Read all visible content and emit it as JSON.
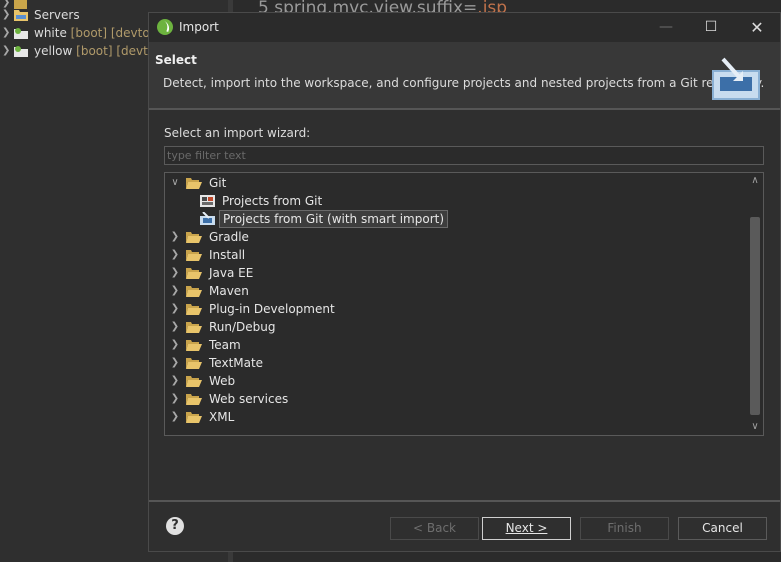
{
  "explorer": {
    "items": [
      {
        "name": "Servers",
        "meta": ""
      },
      {
        "name": "white",
        "meta": "[boot] [devtool"
      },
      {
        "name": "yellow",
        "meta": "[boot] [devtoo"
      }
    ]
  },
  "editor": {
    "line_number": "5",
    "line_text": "spring.mvc.view.suffix=",
    "line_value": ".jsp"
  },
  "dialog": {
    "window_title": "Import",
    "header_title": "Select",
    "header_description": "Detect, import into the workspace, and configure projects and nested projects from a Git repository.",
    "select_label": "Select an import wizard:",
    "filter_placeholder": "type filter text",
    "tree": {
      "git": {
        "label": "Git",
        "children": [
          {
            "label": "Projects from Git"
          },
          {
            "label": "Projects from Git (with smart import)"
          }
        ]
      },
      "categories": [
        "Gradle",
        "Install",
        "Java EE",
        "Maven",
        "Plug-in Development",
        "Run/Debug",
        "Team",
        "TextMate",
        "Web",
        "Web services",
        "XML"
      ]
    },
    "buttons": {
      "back": "< Back",
      "next": "Next >",
      "finish": "Finish",
      "cancel": "Cancel",
      "help": "?"
    }
  },
  "colors": {
    "background": "#2b2b2b",
    "dialog": "#2f2f2f",
    "folder": "#e8c46a",
    "muted": "#b09a6a"
  }
}
